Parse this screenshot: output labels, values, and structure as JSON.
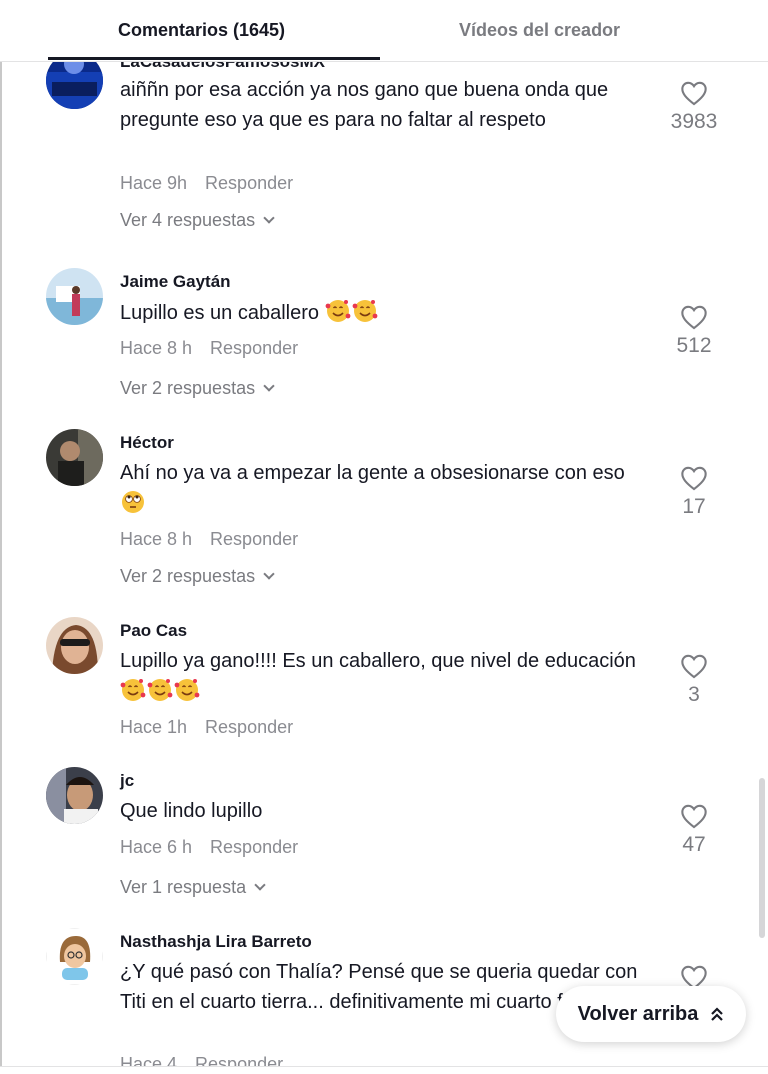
{
  "tabs": {
    "comments": "Comentarios (1645)",
    "creator_videos": "Vídeos del creador"
  },
  "comments": [
    {
      "author": "LaCasadelosFamososMX",
      "text": "aiññn por esa acción ya nos gano que buena onda que pregunte eso ya que es para no faltar al respeto",
      "time": "Hace 9h",
      "reply_label": "Responder",
      "replies": "Ver 4 respuestas",
      "likes": "3983"
    },
    {
      "author": "Jaime Gaytán",
      "text": "Lupillo es un caballero",
      "time": "Hace 8 h",
      "reply_label": "Responder",
      "replies": "Ver 2 respuestas",
      "likes": "512"
    },
    {
      "author": "Héctor",
      "text": "Ahí no ya va a empezar la gente a obsesionarse con eso",
      "time": "Hace 8 h",
      "reply_label": "Responder",
      "replies": "Ver 2 respuestas",
      "likes": "17"
    },
    {
      "author": "Pao Cas",
      "text": "Lupillo ya gano!!!! Es un caballero, que nivel de educación",
      "time": "Hace 1h",
      "reply_label": "Responder",
      "likes": "3"
    },
    {
      "author": "jc",
      "text": "Que lindo lupillo",
      "time": "Hace 6 h",
      "reply_label": "Responder",
      "replies": "Ver 1 respuesta",
      "likes": "47"
    },
    {
      "author": "Nasthashja Lira Barreto",
      "text": "¿Y qué pasó con Thalía? Pensé que se queria quedar con Titi en el cuarto tierra... definitivamente mi cuarto favorito.",
      "time": "Hace 4",
      "reply_label": "Responder"
    }
  ],
  "back_to_top": "Volver arriba",
  "icons": {
    "like": "heart-outline-icon",
    "expand": "chevron-down-icon",
    "back_to_top": "double-chevron-up-icon",
    "emoji_love": "smiling-face-with-hearts",
    "emoji_eyeroll": "face-with-rolling-eyes"
  },
  "colors": {
    "text": "#161823",
    "secondary": "#8a8b91",
    "divider": "#e3e3e4"
  }
}
